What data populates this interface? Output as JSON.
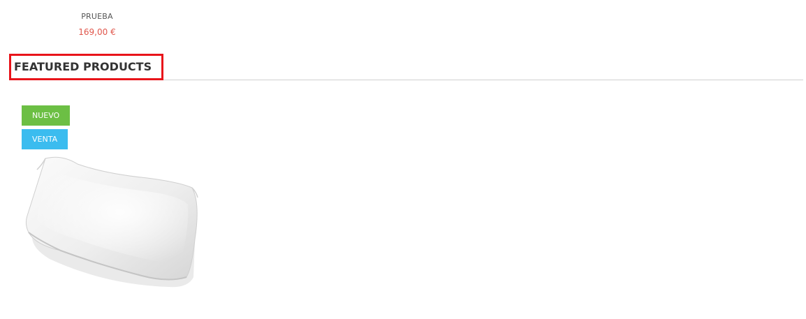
{
  "previous_product": {
    "name": "PRUEBA",
    "price": "169,00 €"
  },
  "section": {
    "title": "FEATURED PRODUCTS"
  },
  "featured_product": {
    "badges": {
      "new": "NUEVO",
      "sale": "VENTA"
    },
    "image_icon": "pillow-image"
  },
  "colors": {
    "price": "#e0564b",
    "badge_new": "#6cbf44",
    "badge_sale": "#3bbcef",
    "highlight_border": "#e8141a"
  }
}
